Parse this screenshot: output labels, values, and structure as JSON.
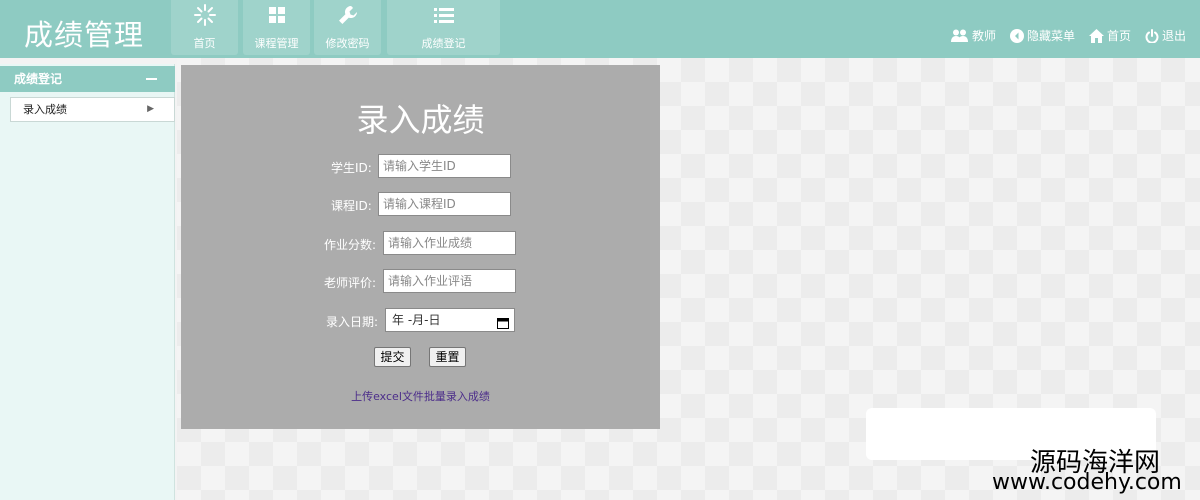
{
  "header": {
    "brand": "成绩管理",
    "nav": [
      {
        "label": "首页",
        "icon": "sun-icon"
      },
      {
        "label": "课程管理",
        "icon": "grid-icon"
      },
      {
        "label": "修改密码",
        "icon": "wrench-icon"
      },
      {
        "label": "成绩登记",
        "icon": "list-icon"
      }
    ],
    "tools": [
      {
        "label": "教师",
        "icon": "users-icon"
      },
      {
        "label": "隐藏菜单",
        "icon": "arrow-left-circle-icon"
      },
      {
        "label": "首页",
        "icon": "home-icon"
      },
      {
        "label": "退出",
        "icon": "power-icon"
      }
    ]
  },
  "sidebar": {
    "title": "成绩登记",
    "items": [
      {
        "label": "录入成绩"
      }
    ]
  },
  "form": {
    "title": "录入成绩",
    "fields": [
      {
        "label": "学生ID:",
        "placeholder": "请输入学生ID"
      },
      {
        "label": "课程ID:",
        "placeholder": "请输入课程ID"
      },
      {
        "label": "作业分数:",
        "placeholder": "请输入作业成绩"
      },
      {
        "label": "老师评价:",
        "placeholder": "请输入作业评语"
      }
    ],
    "date_label": "录入日期:",
    "date_value": "年 -月-日",
    "submit": "提交",
    "reset": "重置",
    "upload_link": "上传excel文件批量录入成绩"
  },
  "watermark": {
    "line1": "源码海洋网",
    "line2": "www.codehy.com"
  },
  "colors": {
    "header": "#8ecbc2",
    "panel": "#acacac",
    "sidebar_bg": "#e9f7f5"
  }
}
